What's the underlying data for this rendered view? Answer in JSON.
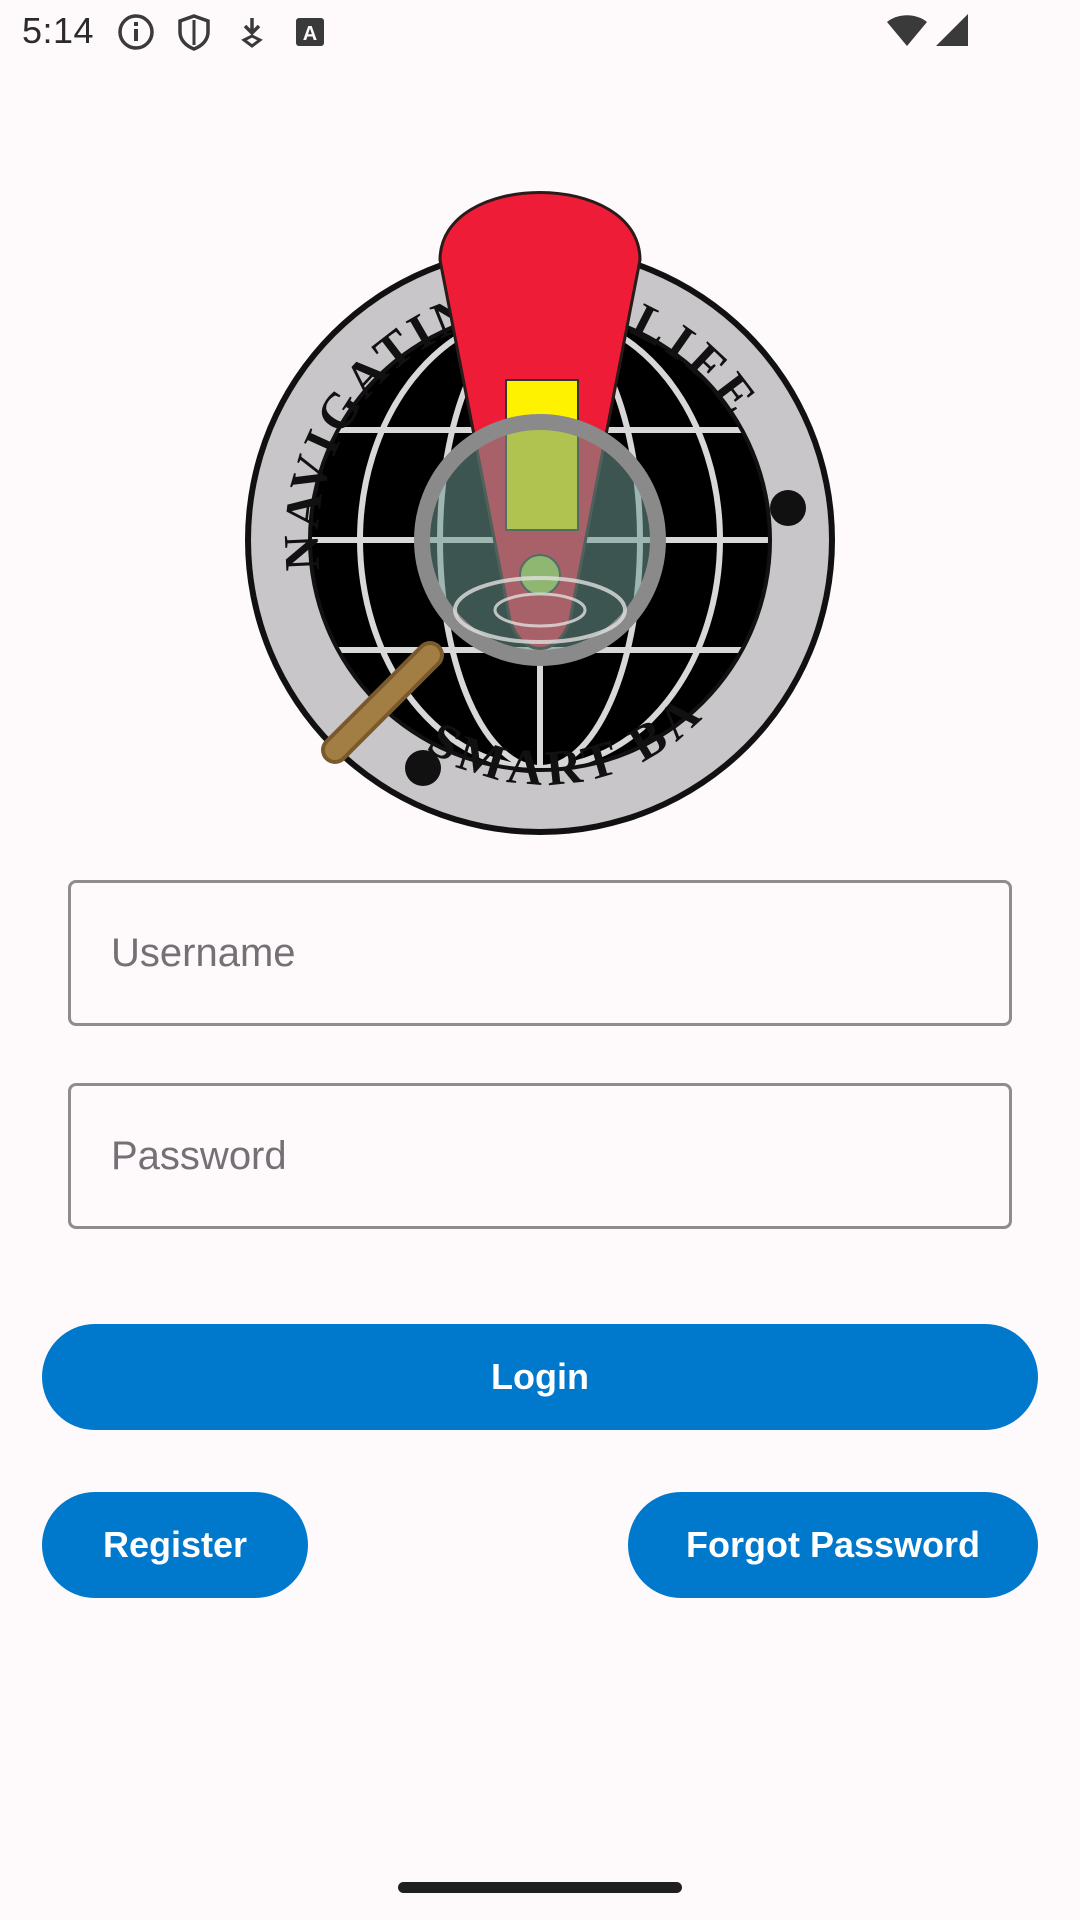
{
  "status_bar": {
    "time": "5:14",
    "icons": [
      "info-icon",
      "shield-icon",
      "download-icon",
      "keyboard-icon",
      "wifi-icon",
      "cell-signal-icon"
    ]
  },
  "logo": {
    "text_top_left": "NAVIGATING",
    "text_top_right": "LIFE",
    "text_bottom": "SMART BAG",
    "colors": {
      "red": "#ee1c36",
      "yellow": "#fff200",
      "ring": "#c8c6c8",
      "globe": "#000000"
    }
  },
  "form": {
    "username_placeholder": "Username",
    "password_placeholder": "Password"
  },
  "buttons": {
    "login": "Login",
    "register": "Register",
    "forgot_password": "Forgot Password"
  },
  "colors": {
    "accent": "#0079cd",
    "background": "#fefafb"
  }
}
